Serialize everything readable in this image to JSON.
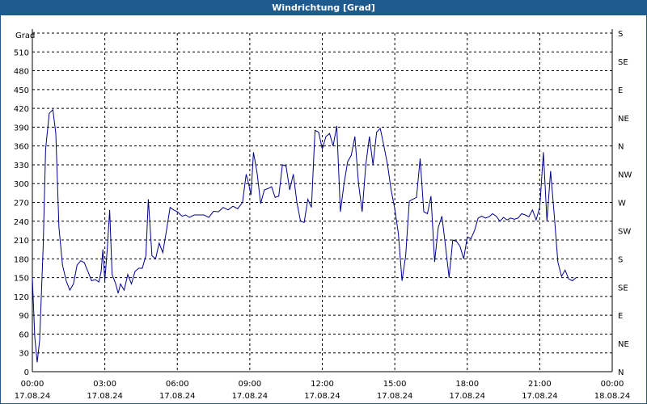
{
  "window": {
    "title": "Windrichtung [Grad]"
  },
  "chart_data": {
    "type": "line",
    "title": "Windrichtung [Grad]",
    "ylabel": "Grad",
    "xlabel": "",
    "ylim": [
      0,
      540
    ],
    "y_ticks": [
      0,
      30,
      60,
      90,
      120,
      150,
      180,
      210,
      240,
      270,
      300,
      330,
      360,
      390,
      420,
      450,
      480,
      510
    ],
    "y2_ticks": [
      {
        "value": 0,
        "label": "N"
      },
      {
        "value": 45,
        "label": "NE"
      },
      {
        "value": 90,
        "label": "E"
      },
      {
        "value": 135,
        "label": "SE"
      },
      {
        "value": 180,
        "label": "S"
      },
      {
        "value": 225,
        "label": "SW"
      },
      {
        "value": 270,
        "label": "W"
      },
      {
        "value": 315,
        "label": "NW"
      },
      {
        "value": 360,
        "label": "N"
      },
      {
        "value": 405,
        "label": "NE"
      },
      {
        "value": 450,
        "label": "E"
      },
      {
        "value": 495,
        "label": "SE"
      },
      {
        "value": 540,
        "label": "S"
      }
    ],
    "x_range_hours": [
      0,
      24
    ],
    "x_ticks": [
      {
        "hour": 0,
        "time": "00:00",
        "date": "17.08.24"
      },
      {
        "hour": 3,
        "time": "03:00",
        "date": "17.08.24"
      },
      {
        "hour": 6,
        "time": "06:00",
        "date": "17.08.24"
      },
      {
        "hour": 9,
        "time": "09:00",
        "date": "17.08.24"
      },
      {
        "hour": 12,
        "time": "12:00",
        "date": "17.08.24"
      },
      {
        "hour": 15,
        "time": "15:00",
        "date": "17.08.24"
      },
      {
        "hour": 18,
        "time": "18:00",
        "date": "17.08.24"
      },
      {
        "hour": 21,
        "time": "21:00",
        "date": "17.08.24"
      },
      {
        "hour": 24,
        "time": "00:00",
        "date": "18.08.24"
      }
    ],
    "grid": true,
    "line_color": "#00008b",
    "series": [
      {
        "points": [
          [
            0.0,
            150
          ],
          [
            0.1,
            55
          ],
          [
            0.2,
            15
          ],
          [
            0.3,
            50
          ],
          [
            0.45,
            200
          ],
          [
            0.55,
            355
          ],
          [
            0.7,
            412
          ],
          [
            0.85,
            418
          ],
          [
            0.97,
            380
          ],
          [
            1.1,
            230
          ],
          [
            1.25,
            170
          ],
          [
            1.4,
            145
          ],
          [
            1.55,
            130
          ],
          [
            1.7,
            140
          ],
          [
            1.85,
            170
          ],
          [
            2.0,
            177
          ],
          [
            2.15,
            174
          ],
          [
            2.3,
            160
          ],
          [
            2.45,
            145
          ],
          [
            2.6,
            147
          ],
          [
            2.75,
            143
          ],
          [
            2.85,
            160
          ],
          [
            2.92,
            195
          ],
          [
            3.0,
            145
          ],
          [
            3.1,
            195
          ],
          [
            3.2,
            258
          ],
          [
            3.3,
            155
          ],
          [
            3.45,
            140
          ],
          [
            3.55,
            125
          ],
          [
            3.65,
            140
          ],
          [
            3.8,
            130
          ],
          [
            3.95,
            155
          ],
          [
            4.1,
            140
          ],
          [
            4.25,
            160
          ],
          [
            4.4,
            165
          ],
          [
            4.55,
            165
          ],
          [
            4.7,
            185
          ],
          [
            4.8,
            275
          ],
          [
            4.95,
            185
          ],
          [
            5.1,
            180
          ],
          [
            5.25,
            205
          ],
          [
            5.4,
            190
          ],
          [
            5.55,
            225
          ],
          [
            5.7,
            262
          ],
          [
            5.85,
            258
          ],
          [
            6.0,
            255
          ],
          [
            6.2,
            248
          ],
          [
            6.35,
            250
          ],
          [
            6.5,
            246
          ],
          [
            6.7,
            250
          ],
          [
            6.9,
            250
          ],
          [
            7.1,
            250
          ],
          [
            7.3,
            246
          ],
          [
            7.5,
            256
          ],
          [
            7.7,
            255
          ],
          [
            7.9,
            262
          ],
          [
            8.1,
            258
          ],
          [
            8.3,
            264
          ],
          [
            8.5,
            260
          ],
          [
            8.7,
            270
          ],
          [
            8.85,
            315
          ],
          [
            8.95,
            300
          ],
          [
            9.05,
            282
          ],
          [
            9.15,
            350
          ],
          [
            9.3,
            318
          ],
          [
            9.45,
            268
          ],
          [
            9.6,
            290
          ],
          [
            9.75,
            292
          ],
          [
            9.9,
            295
          ],
          [
            10.05,
            278
          ],
          [
            10.2,
            280
          ],
          [
            10.35,
            330
          ],
          [
            10.5,
            328
          ],
          [
            10.65,
            290
          ],
          [
            10.8,
            315
          ],
          [
            10.95,
            270
          ],
          [
            11.1,
            240
          ],
          [
            11.25,
            238
          ],
          [
            11.4,
            275
          ],
          [
            11.55,
            262
          ],
          [
            11.7,
            385
          ],
          [
            11.85,
            382
          ],
          [
            12.0,
            355
          ],
          [
            12.15,
            375
          ],
          [
            12.3,
            380
          ],
          [
            12.45,
            360
          ],
          [
            12.6,
            392
          ],
          [
            12.75,
            255
          ],
          [
            12.9,
            300
          ],
          [
            13.05,
            335
          ],
          [
            13.2,
            345
          ],
          [
            13.35,
            375
          ],
          [
            13.5,
            300
          ],
          [
            13.65,
            255
          ],
          [
            13.8,
            330
          ],
          [
            13.95,
            375
          ],
          [
            14.1,
            330
          ],
          [
            14.25,
            382
          ],
          [
            14.4,
            388
          ],
          [
            14.55,
            360
          ],
          [
            14.7,
            330
          ],
          [
            14.85,
            290
          ],
          [
            15.0,
            260
          ],
          [
            15.15,
            220
          ],
          [
            15.3,
            145
          ],
          [
            15.45,
            185
          ],
          [
            15.6,
            272
          ],
          [
            15.75,
            275
          ],
          [
            15.9,
            278
          ],
          [
            16.05,
            340
          ],
          [
            16.2,
            255
          ],
          [
            16.35,
            252
          ],
          [
            16.5,
            280
          ],
          [
            16.65,
            175
          ],
          [
            16.8,
            230
          ],
          [
            16.95,
            248
          ],
          [
            17.1,
            200
          ],
          [
            17.25,
            150
          ],
          [
            17.4,
            210
          ],
          [
            17.55,
            208
          ],
          [
            17.7,
            200
          ],
          [
            17.85,
            180
          ],
          [
            18.0,
            215
          ],
          [
            18.15,
            212
          ],
          [
            18.3,
            225
          ],
          [
            18.45,
            245
          ],
          [
            18.6,
            248
          ],
          [
            18.75,
            245
          ],
          [
            18.9,
            247
          ],
          [
            19.05,
            252
          ],
          [
            19.2,
            248
          ],
          [
            19.35,
            240
          ],
          [
            19.5,
            246
          ],
          [
            19.65,
            242
          ],
          [
            19.8,
            245
          ],
          [
            19.95,
            243
          ],
          [
            20.1,
            245
          ],
          [
            20.25,
            252
          ],
          [
            20.4,
            250
          ],
          [
            20.55,
            247
          ],
          [
            20.7,
            258
          ],
          [
            20.85,
            242
          ],
          [
            21.0,
            262
          ],
          [
            21.15,
            350
          ],
          [
            21.3,
            240
          ],
          [
            21.45,
            320
          ],
          [
            21.6,
            250
          ],
          [
            21.75,
            175
          ],
          [
            21.9,
            152
          ],
          [
            22.05,
            162
          ],
          [
            22.2,
            148
          ],
          [
            22.35,
            145
          ],
          [
            22.5,
            150
          ]
        ]
      }
    ]
  }
}
